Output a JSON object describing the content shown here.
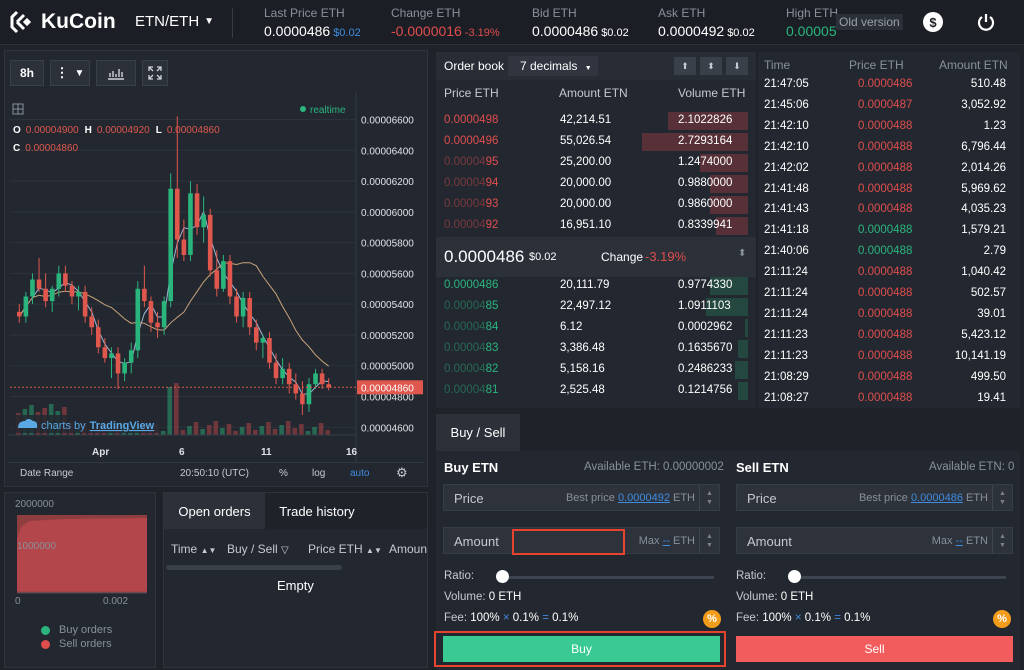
{
  "header": {
    "logo_text": "KuCoin",
    "pair": "ETN/ETH",
    "stats": [
      {
        "label": "Last Price ETH",
        "value": "0.0000486",
        "sub": "$0.02",
        "sub_color": "blue"
      },
      {
        "label": "Change ETH",
        "value": "-0.0000016",
        "sub": "-3.19%",
        "value_color": "red",
        "sub_color": "red"
      },
      {
        "label": "Bid ETH",
        "value": "0.0000486",
        "sub": "$0.02"
      },
      {
        "label": "Ask ETH",
        "value": "0.0000492",
        "sub": "$0.02"
      },
      {
        "label": "High ETH",
        "value": "0.00005",
        "value_color": "green"
      }
    ],
    "old_version": "Old version",
    "dollar_icon": "$"
  },
  "chart": {
    "interval": "8h",
    "realtime": "realtime",
    "ohlc": {
      "o_label": "O",
      "o": "0.00004900",
      "h_label": "H",
      "h": "0.00004920",
      "l_label": "L",
      "l": "0.00004860",
      "c_label": "C",
      "c": "0.00004860"
    },
    "attribution_prefix": "charts by",
    "attribution_link": "TradingView",
    "footer": {
      "date_range": "Date Range",
      "time": "20:50:10 (UTC)",
      "pct": "%",
      "log": "log",
      "auto": "auto"
    },
    "current_price_tag": "0.00004860"
  },
  "chart_data": {
    "type": "candlestick",
    "y_ticks": [
      "0.00006600",
      "0.00006400",
      "0.00006200",
      "0.00006000",
      "0.00005800",
      "0.00005600",
      "0.00005400",
      "0.00005200",
      "0.00005000",
      "0.00004800",
      "0.00004600"
    ],
    "ylim": [
      4.55e-05,
      6.72e-05
    ],
    "x_ticks": [
      "Apr",
      "6",
      "11",
      "16"
    ],
    "candles": [
      [
        5.35e-05,
        5.4e-05,
        5.28e-05,
        5.32e-05
      ],
      [
        5.32e-05,
        5.48e-05,
        5.28e-05,
        5.45e-05
      ],
      [
        5.45e-05,
        5.6e-05,
        5.4e-05,
        5.56e-05
      ],
      [
        5.56e-05,
        5.7e-05,
        5.48e-05,
        5.5e-05
      ],
      [
        5.5e-05,
        5.6e-05,
        5.38e-05,
        5.42e-05
      ],
      [
        5.42e-05,
        5.52e-05,
        5.35e-05,
        5.5e-05
      ],
      [
        5.5e-05,
        5.65e-05,
        5.45e-05,
        5.6e-05
      ],
      [
        5.6e-05,
        5.65e-05,
        5.48e-05,
        5.52e-05
      ],
      [
        5.52e-05,
        5.55e-05,
        5.4e-05,
        5.45e-05
      ],
      [
        5.45e-05,
        5.52e-05,
        5.36e-05,
        5.48e-05
      ],
      [
        5.48e-05,
        5.52e-05,
        5.28e-05,
        5.32e-05
      ],
      [
        5.32e-05,
        5.38e-05,
        5.2e-05,
        5.25e-05
      ],
      [
        5.25e-05,
        5.3e-05,
        5.08e-05,
        5.12e-05
      ],
      [
        5.12e-05,
        5.18e-05,
        5.02e-05,
        5.05e-05
      ],
      [
        5.05e-05,
        5.12e-05,
        4.92e-05,
        5.08e-05
      ],
      [
        5.08e-05,
        5.12e-05,
        4.85e-05,
        4.95e-05
      ],
      [
        4.95e-05,
        5.05e-05,
        4.9e-05,
        5.02e-05
      ],
      [
        5.02e-05,
        5.15e-05,
        4.95e-05,
        5.1e-05
      ],
      [
        5.1e-05,
        5.55e-05,
        5.05e-05,
        5.5e-05
      ],
      [
        5.5e-05,
        5.65e-05,
        5.38e-05,
        5.42e-05
      ],
      [
        5.42e-05,
        5.45e-05,
        5.22e-05,
        5.28e-05
      ],
      [
        5.28e-05,
        5.35e-05,
        5.18e-05,
        5.25e-05
      ],
      [
        5.25e-05,
        5.45e-05,
        5.2e-05,
        5.42e-05
      ],
      [
        5.42e-05,
        6.25e-05,
        5.38e-05,
        6.15e-05
      ],
      [
        6.15e-05,
        6.62e-05,
        5.7e-05,
        5.82e-05
      ],
      [
        5.82e-05,
        5.95e-05,
        5.68e-05,
        5.72e-05
      ],
      [
        5.72e-05,
        6.2e-05,
        5.68e-05,
        6.12e-05
      ],
      [
        6.12e-05,
        6.18e-05,
        5.85e-05,
        5.9e-05
      ],
      [
        5.9e-05,
        6.1e-05,
        5.8e-05,
        5.98e-05
      ],
      [
        5.98e-05,
        6.02e-05,
        5.58e-05,
        5.62e-05
      ],
      [
        5.62e-05,
        5.75e-05,
        5.45e-05,
        5.5e-05
      ],
      [
        5.5e-05,
        5.72e-05,
        5.48e-05,
        5.68e-05
      ],
      [
        5.68e-05,
        5.72e-05,
        5.4e-05,
        5.45e-05
      ],
      [
        5.45e-05,
        5.5e-05,
        5.28e-05,
        5.32e-05
      ],
      [
        5.32e-05,
        5.48e-05,
        5.25e-05,
        5.44e-05
      ],
      [
        5.44e-05,
        5.48e-05,
        5.2e-05,
        5.25e-05
      ],
      [
        5.25e-05,
        5.3e-05,
        5.1e-05,
        5.15e-05
      ],
      [
        5.15e-05,
        5.2e-05,
        5.05e-05,
        5.18e-05
      ],
      [
        5.18e-05,
        5.22e-05,
        4.98e-05,
        5.02e-05
      ],
      [
        5.02e-05,
        5.08e-05,
        4.88e-05,
        4.92e-05
      ],
      [
        4.92e-05,
        5.05e-05,
        4.88e-05,
        4.98e-05
      ],
      [
        4.98e-05,
        5.02e-05,
        4.82e-05,
        4.88e-05
      ],
      [
        4.88e-05,
        4.95e-05,
        4.78e-05,
        4.82e-05
      ],
      [
        4.82e-05,
        4.9e-05,
        4.68e-05,
        4.75e-05
      ],
      [
        4.75e-05,
        4.92e-05,
        4.7e-05,
        4.88e-05
      ],
      [
        4.88e-05,
        4.98e-05,
        4.85e-05,
        4.95e-05
      ],
      [
        4.95e-05,
        4.98e-05,
        4.85e-05,
        4.88e-05
      ],
      [
        4.88e-05,
        4.92e-05,
        4.84e-05,
        4.86e-05
      ]
    ]
  },
  "depth": {
    "y_top": "2000000",
    "y_mid": "1000000",
    "x_left": "0",
    "x_right": "0.002",
    "legend_buy": "Buy orders",
    "legend_sell": "Sell orders"
  },
  "orders": {
    "tab_open": "Open orders",
    "tab_history": "Trade history",
    "columns": [
      "Time",
      "Buy / Sell",
      "Price ETH",
      "Amoun"
    ],
    "empty": "Empty"
  },
  "order_book": {
    "title": "Order book",
    "decimals": "7 decimals",
    "headers": [
      "Price ETH",
      "Amount ETN",
      "Volume ETH"
    ],
    "asks": [
      {
        "price_dim": "",
        "price_hi": "0.0000498",
        "amount": "42,214.51",
        "volume": "2.1022826",
        "depth": 0.25
      },
      {
        "price_dim": "",
        "price_hi": "0.0000496",
        "amount": "55,026.54",
        "volume": "2.7293164",
        "depth": 0.33
      },
      {
        "price_dim": "0.00004",
        "price_hi": "95",
        "amount": "25,200.00",
        "volume": "1.2474000",
        "depth": 0.15
      },
      {
        "price_dim": "0.00004",
        "price_hi": "94",
        "amount": "20,000.00",
        "volume": "0.9880000",
        "depth": 0.12
      },
      {
        "price_dim": "0.00004",
        "price_hi": "93",
        "amount": "20,000.00",
        "volume": "0.9860000",
        "depth": 0.12
      },
      {
        "price_dim": "0.00004",
        "price_hi": "92",
        "amount": "16,951.10",
        "volume": "0.8339941",
        "depth": 0.1
      }
    ],
    "mid_price": "0.0000486",
    "mid_usd": "$0.02",
    "change_label": "Change",
    "change_value": "-3.19%",
    "bids": [
      {
        "price_dim": "",
        "price_hi": "0.0000486",
        "amount": "20,111.79",
        "volume": "0.9774330",
        "depth": 0.12
      },
      {
        "price_dim": "0.00004",
        "price_hi": "85",
        "amount": "22,497.12",
        "volume": "1.0911103",
        "depth": 0.13
      },
      {
        "price_dim": "0.00004",
        "price_hi": "84",
        "amount": "6.12",
        "volume": "0.0002962",
        "depth": 0.01
      },
      {
        "price_dim": "0.00004",
        "price_hi": "83",
        "amount": "3,386.48",
        "volume": "0.1635670",
        "depth": 0.03
      },
      {
        "price_dim": "0.00004",
        "price_hi": "82",
        "amount": "5,158.16",
        "volume": "0.2486233",
        "depth": 0.04
      },
      {
        "price_dim": "0.00004",
        "price_hi": "81",
        "amount": "2,525.48",
        "volume": "0.1214756",
        "depth": 0.03
      }
    ]
  },
  "trade_history": {
    "headers": [
      "Time",
      "Price ETH",
      "Amount ETN"
    ],
    "rows": [
      {
        "time": "21:47:05",
        "price": "0.0000486",
        "amount": "510.48",
        "side": "red"
      },
      {
        "time": "21:45:06",
        "price": "0.0000487",
        "amount": "3,052.92",
        "side": "red"
      },
      {
        "time": "21:42:10",
        "price": "0.0000488",
        "amount": "1.23",
        "side": "red"
      },
      {
        "time": "21:42:10",
        "price": "0.0000488",
        "amount": "6,796.44",
        "side": "red"
      },
      {
        "time": "21:42:02",
        "price": "0.0000488",
        "amount": "2,014.26",
        "side": "red"
      },
      {
        "time": "21:41:48",
        "price": "0.0000488",
        "amount": "5,969.62",
        "side": "red"
      },
      {
        "time": "21:41:43",
        "price": "0.0000488",
        "amount": "4,035.23",
        "side": "red"
      },
      {
        "time": "21:41:18",
        "price": "0.0000488",
        "amount": "1,579.21",
        "side": "green"
      },
      {
        "time": "21:40:06",
        "price": "0.0000488",
        "amount": "2.79",
        "side": "green"
      },
      {
        "time": "21:11:24",
        "price": "0.0000488",
        "amount": "1,040.42",
        "side": "red"
      },
      {
        "time": "21:11:24",
        "price": "0.0000488",
        "amount": "502.57",
        "side": "red"
      },
      {
        "time": "21:11:24",
        "price": "0.0000488",
        "amount": "39.01",
        "side": "red"
      },
      {
        "time": "21:11:23",
        "price": "0.0000488",
        "amount": "5,423.12",
        "side": "red"
      },
      {
        "time": "21:11:23",
        "price": "0.0000488",
        "amount": "10,141.19",
        "side": "red"
      },
      {
        "time": "21:08:29",
        "price": "0.0000488",
        "amount": "499.50",
        "side": "red"
      },
      {
        "time": "21:08:27",
        "price": "0.0000488",
        "amount": "19.41",
        "side": "red"
      }
    ]
  },
  "trade_form": {
    "tab": "Buy / Sell",
    "buy": {
      "title": "Buy ETN",
      "available": "Available ETH: 0.00000002",
      "price_label": "Price",
      "best_price_prefix": "Best price",
      "best_price_value": "0.0000492",
      "currency": "ETH",
      "amount_label": "Amount",
      "amount_value": "",
      "max_prefix": "Max",
      "max_value": "--",
      "max_currency": "ETH",
      "ratio_label": "Ratio:",
      "volume_label": "Volume:",
      "volume_value": "0 ETH",
      "fee_label": "Fee:",
      "fee_pct": "100%",
      "fee_times": "×",
      "fee_rate": "0.1%",
      "fee_eq": "=",
      "fee_result": "0.1%",
      "button": "Buy"
    },
    "sell": {
      "title": "Sell ETN",
      "available": "Available ETN: 0",
      "price_label": "Price",
      "best_price_prefix": "Best price",
      "best_price_value": "0.0000486",
      "currency": "ETH",
      "amount_label": "Amount",
      "max_prefix": "Max",
      "max_value": "--",
      "max_currency": "ETN",
      "ratio_label": "Ratio:",
      "volume_label": "Volume:",
      "volume_value": "0 ETH",
      "fee_label": "Fee:",
      "fee_pct": "100%",
      "fee_times": "×",
      "fee_rate": "0.1%",
      "fee_eq": "=",
      "fee_result": "0.1%",
      "button": "Sell"
    },
    "fee_icon": "%"
  },
  "colors": {
    "bg": "#1e2229",
    "panel": "#232830",
    "red": "#e04d4d",
    "green": "#2ab57d",
    "blue": "#3f8ce0",
    "buy_button": "#39c993",
    "sell_button": "#f25c5c",
    "highlight_box": "#e8432f"
  }
}
